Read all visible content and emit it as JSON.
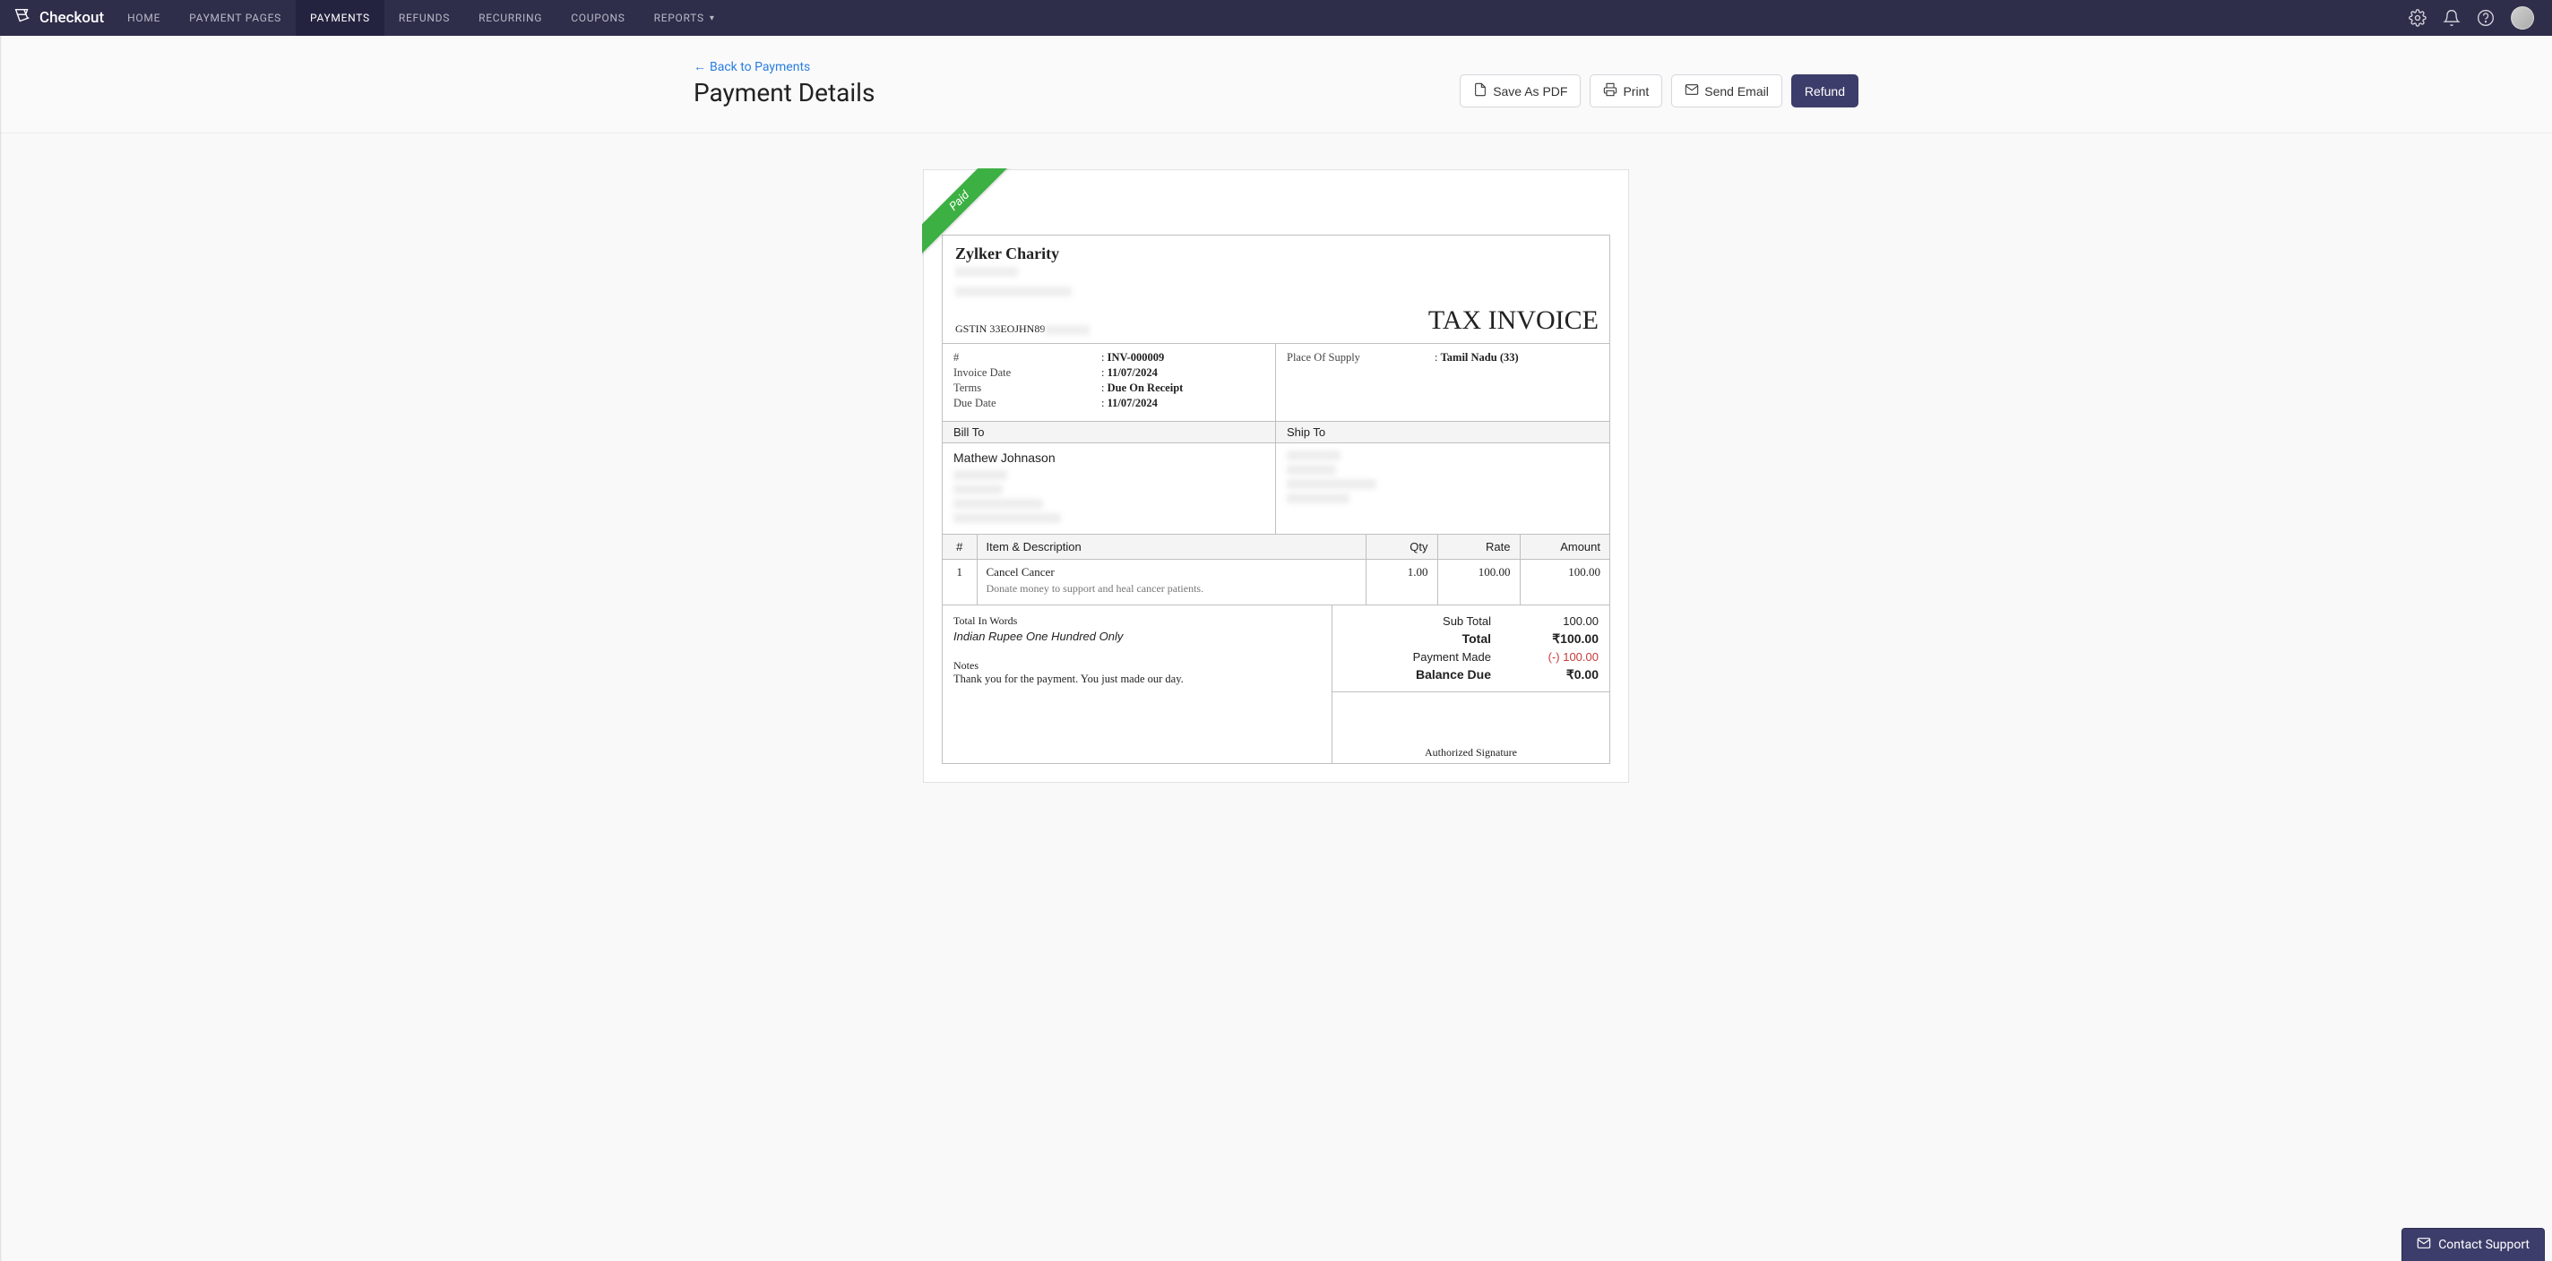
{
  "brand": "Checkout",
  "nav": [
    {
      "label": "HOME"
    },
    {
      "label": "PAYMENT PAGES"
    },
    {
      "label": "PAYMENTS",
      "active": true
    },
    {
      "label": "REFUNDS"
    },
    {
      "label": "RECURRING"
    },
    {
      "label": "COUPONS"
    },
    {
      "label": "REPORTS",
      "dropdown": true
    }
  ],
  "header": {
    "back_label": "Back to Payments",
    "title": "Payment Details",
    "actions": {
      "save_pdf": "Save As PDF",
      "print": "Print",
      "send_email": "Send Email",
      "refund": "Refund"
    }
  },
  "ribbon": "Paid",
  "invoice": {
    "company_name": "Zylker Charity",
    "gstin_label": "GSTIN",
    "gstin_value": "33EOJHN89",
    "doc_title": "TAX INVOICE",
    "meta_left": {
      "number_label": "#",
      "number_value": "INV-000009",
      "invoice_date_label": "Invoice Date",
      "invoice_date_value": "11/07/2024",
      "terms_label": "Terms",
      "terms_value": "Due On Receipt",
      "due_date_label": "Due Date",
      "due_date_value": "11/07/2024"
    },
    "meta_right": {
      "pos_label": "Place Of Supply",
      "pos_value": "Tamil Nadu (33)"
    },
    "bill_to_label": "Bill To",
    "ship_to_label": "Ship To",
    "bill_to_name": "Mathew Johnason",
    "table": {
      "headers": {
        "idx": "#",
        "item": "Item & Description",
        "qty": "Qty",
        "rate": "Rate",
        "amount": "Amount"
      },
      "rows": [
        {
          "idx": "1",
          "name": "Cancel Cancer",
          "desc": "Donate money to support and heal cancer patients.",
          "qty": "1.00",
          "rate": "100.00",
          "amount": "100.00"
        }
      ]
    },
    "words_label": "Total In Words",
    "words_value": "Indian Rupee One Hundred Only",
    "notes_label": "Notes",
    "notes_text": "Thank you for the payment. You just made our day.",
    "totals": {
      "subtotal_label": "Sub Total",
      "subtotal_value": "100.00",
      "total_label": "Total",
      "total_value": "₹100.00",
      "payment_made_label": "Payment Made",
      "payment_made_value": "(-) 100.00",
      "balance_label": "Balance Due",
      "balance_value": "₹0.00"
    },
    "signature_label": "Authorized Signature"
  },
  "contact_support": "Contact Support"
}
